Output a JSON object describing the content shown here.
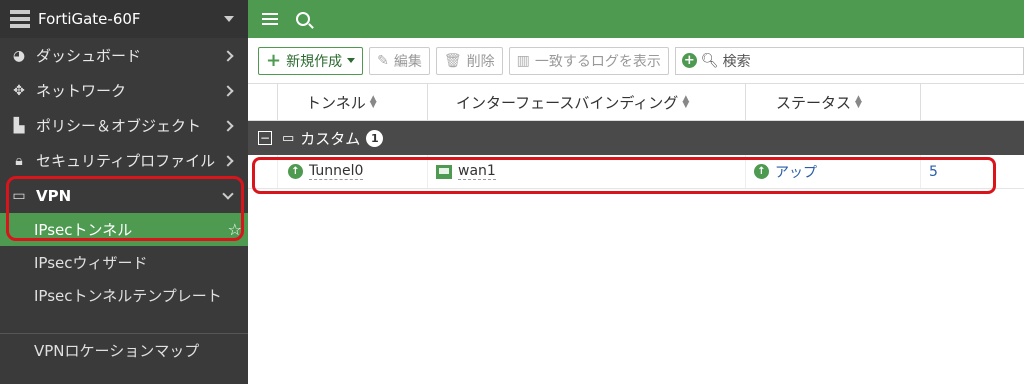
{
  "sidebar": {
    "device": "FortiGate-60F",
    "items": [
      {
        "label": "ダッシュボード",
        "icon": "dashboard-icon"
      },
      {
        "label": "ネットワーク",
        "icon": "network-icon"
      },
      {
        "label": "ポリシー＆オブジェクト",
        "icon": "policy-icon"
      },
      {
        "label": "セキュリティプロファイル",
        "icon": "lock-icon"
      }
    ],
    "vpn_label": "VPN",
    "vpn_sub": [
      {
        "label": "IPsecトンネル",
        "active": true
      },
      {
        "label": "IPsecウィザード"
      },
      {
        "label": "IPsecトンネルテンプレート"
      },
      {
        "label": "VPNロケーションマップ"
      }
    ]
  },
  "toolbar": {
    "new_label": "新規作成",
    "edit_label": "編集",
    "delete_label": "削除",
    "logs_label": "一致するログを表示",
    "search_placeholder": "検索"
  },
  "table": {
    "columns": [
      "トンネル",
      "インターフェースバインディング",
      "ステータス"
    ],
    "group": {
      "label": "カスタム",
      "count": "1"
    },
    "rows": [
      {
        "tunnel": "Tunnel0",
        "interface": "wan1",
        "status": "アップ",
        "ref": "5"
      }
    ]
  },
  "colors": {
    "accent": "#4e9a51",
    "highlight": "#d9141b"
  }
}
